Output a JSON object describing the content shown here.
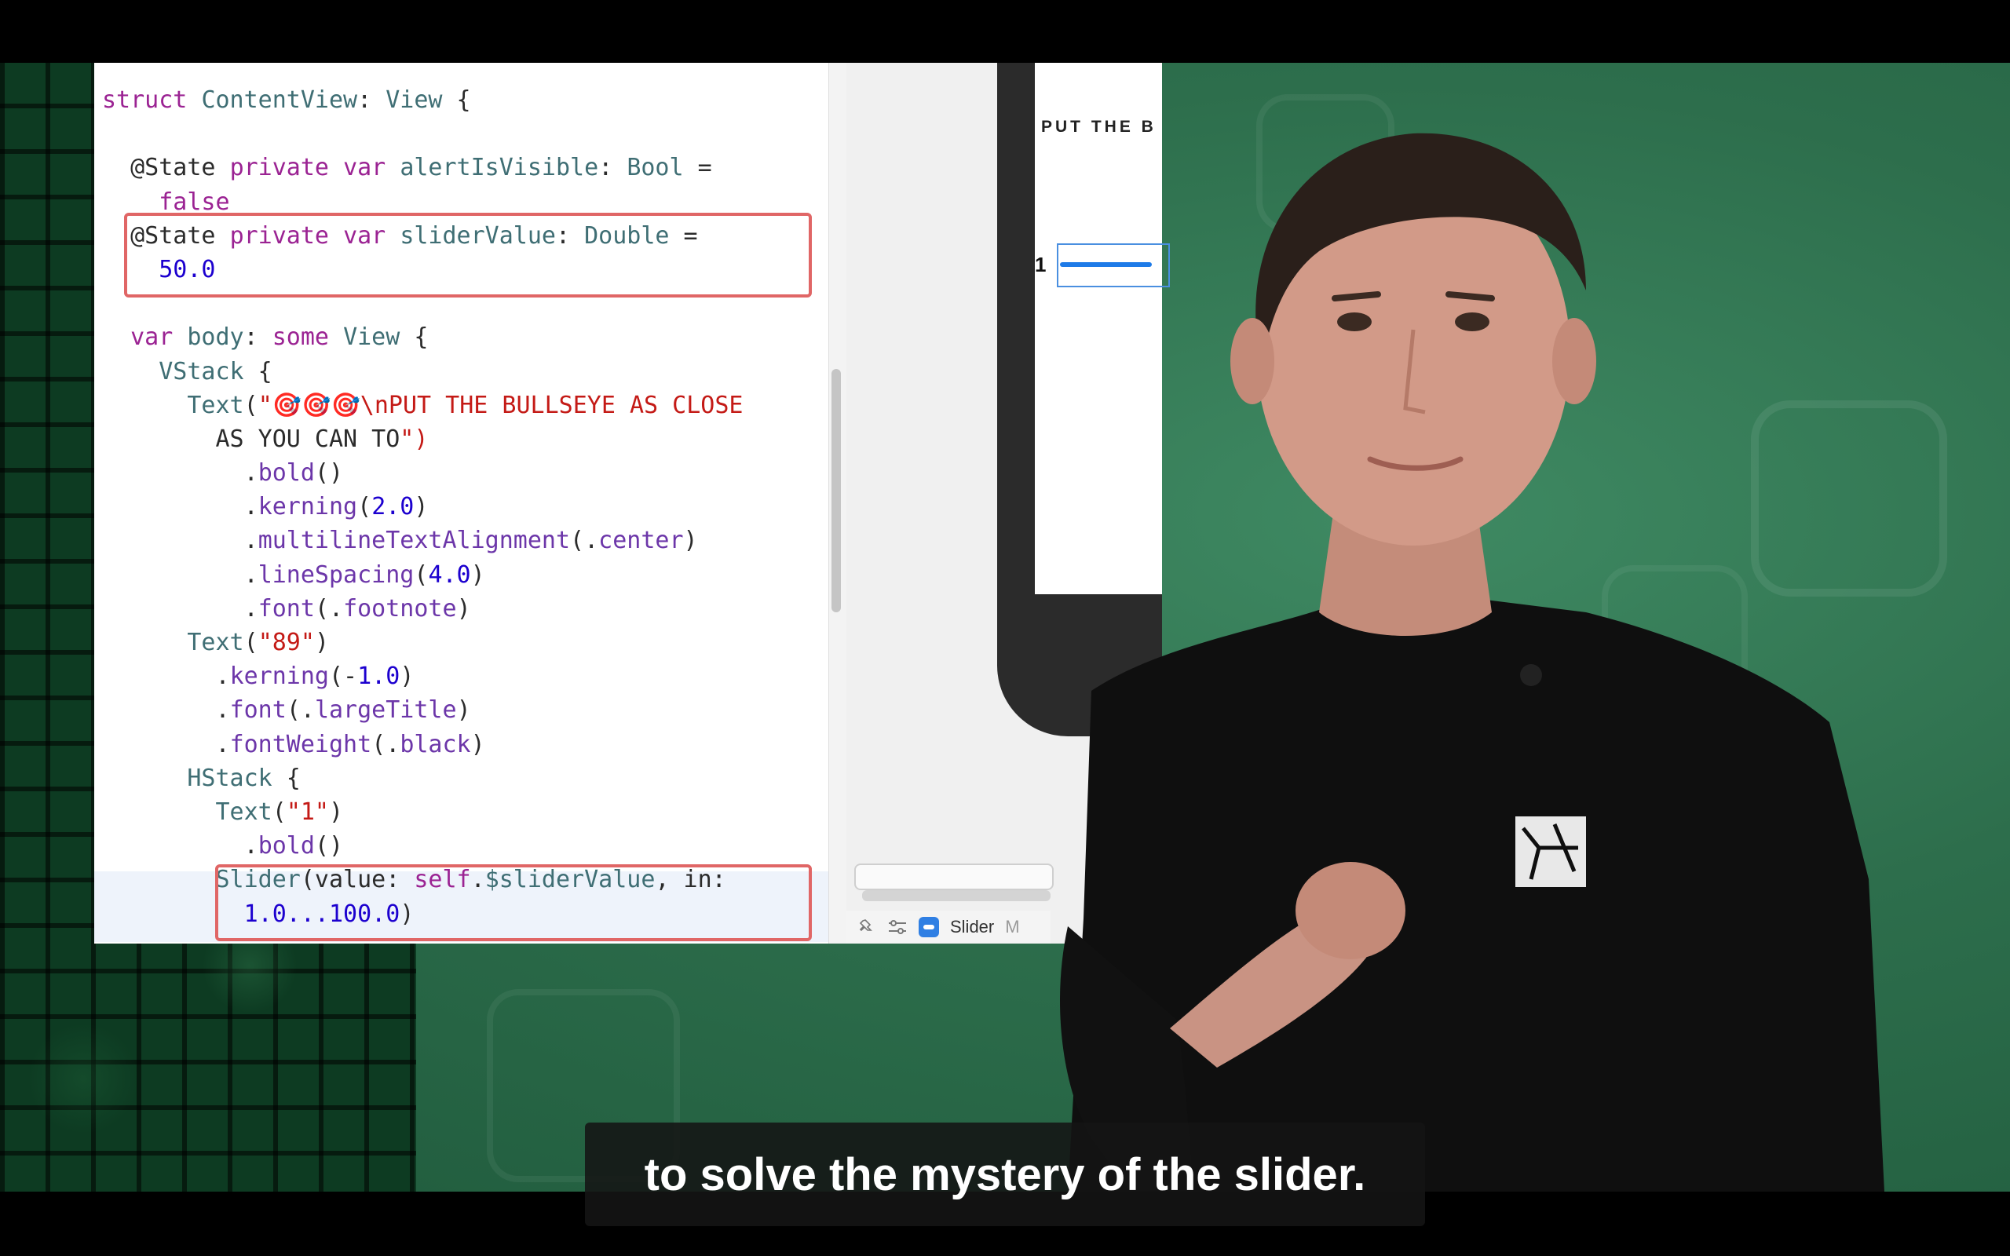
{
  "code": {
    "lines": [
      "struct ContentView: View {",
      "",
      "  @State private var alertIsVisible: Bool =",
      "    false",
      "  @State private var sliderValue: Double =",
      "    50.0",
      "",
      "  var body: some View {",
      "    VStack {",
      "      Text(\"🎯🎯🎯\\nPUT THE BULLSEYE AS CLOSE",
      "        AS YOU CAN TO\")",
      "          .bold()",
      "          .kerning(2.0)",
      "          .multilineTextAlignment(.center)",
      "          .lineSpacing(4.0)",
      "          .font(.footnote)",
      "      Text(\"89\")",
      "        .kerning(-1.0)",
      "        .font(.largeTitle)",
      "        .fontWeight(.black)",
      "      HStack {",
      "        Text(\"1\")",
      "          .bold()",
      "        Slider(value: self.$sliderValue, in:",
      "          1.0...100.0)"
    ]
  },
  "preview": {
    "heading": "PUT THE B",
    "slider_min_label": "1",
    "slider_fill_fraction": 0.9,
    "status_item_label": "Slider",
    "status_item_trailing": "M"
  },
  "caption": {
    "text": "to solve the mystery of the slider."
  },
  "colors": {
    "backdrop": "#2d6e4c",
    "keyword": "#9b2393",
    "string": "#c41a16",
    "number": "#1c00cf",
    "highlight_box": "#e06666",
    "slider_accent": "#1e7be8"
  }
}
